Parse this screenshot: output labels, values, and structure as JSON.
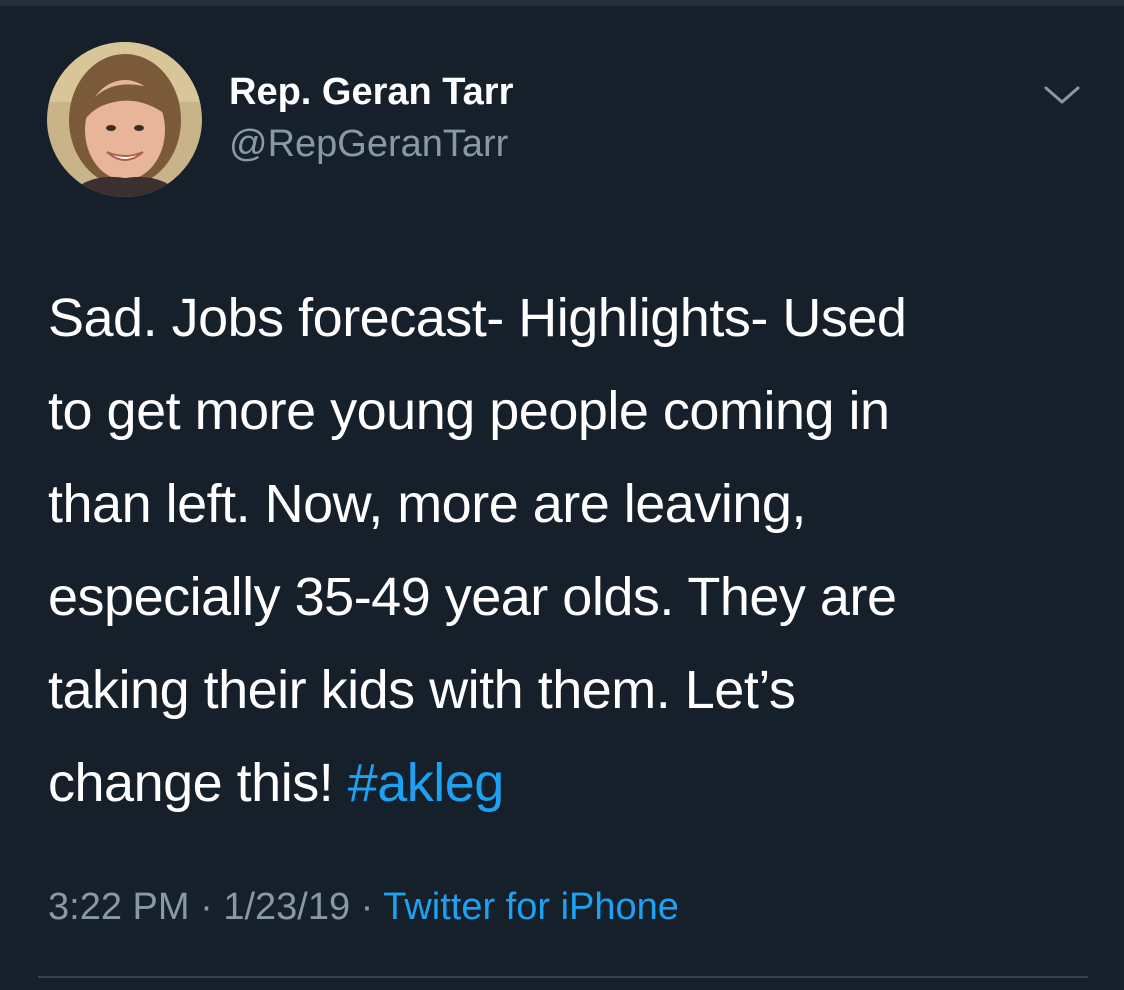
{
  "tweet": {
    "author_name": "Rep. Geran Tarr",
    "author_handle": "@RepGeranTarr",
    "text_lines": [
      "Sad. Jobs forecast- Highlights- Used",
      "to get more young people coming in",
      "than left. Now, more are leaving,",
      "especially 35-49 year olds. They are",
      "taking their kids with them. Let’s"
    ],
    "text_last_line_prefix": "change this! ",
    "hashtag": "#akleg",
    "time": "3:22 PM",
    "date": "1/23/19",
    "separator": "·",
    "source": "Twitter for iPhone"
  },
  "icons": {
    "menu": "chevron-down-icon",
    "avatar": "profile-photo"
  },
  "colors": {
    "background": "#15202b",
    "text": "#ffffff",
    "secondary_text": "#8899a6",
    "link": "#1da1f2",
    "divider": "#38444d"
  }
}
